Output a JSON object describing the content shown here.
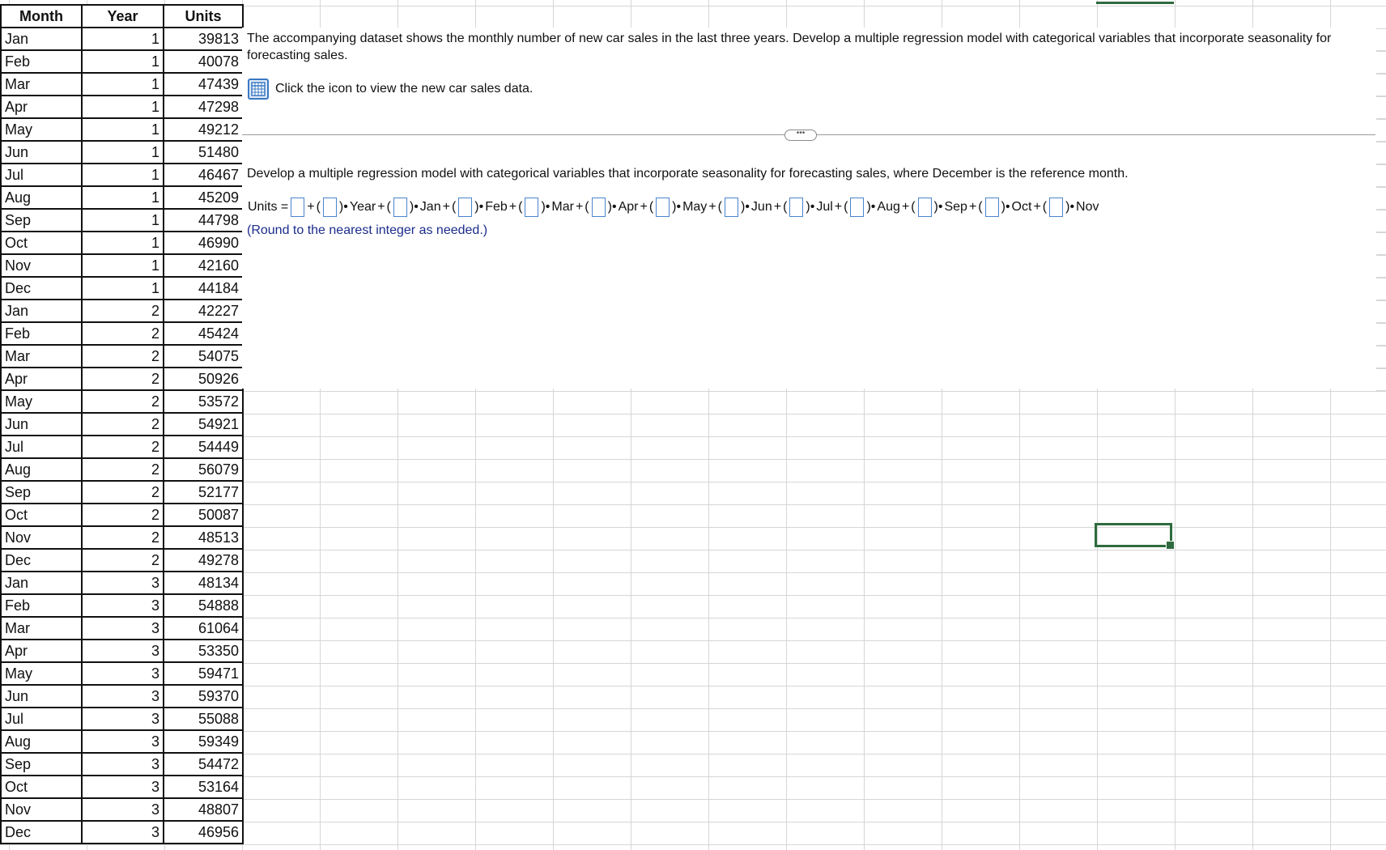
{
  "table": {
    "headers": [
      "Month",
      "Year",
      "Units"
    ],
    "rows": [
      [
        "Jan",
        "1",
        "39813"
      ],
      [
        "Feb",
        "1",
        "40078"
      ],
      [
        "Mar",
        "1",
        "47439"
      ],
      [
        "Apr",
        "1",
        "47298"
      ],
      [
        "May",
        "1",
        "49212"
      ],
      [
        "Jun",
        "1",
        "51480"
      ],
      [
        "Jul",
        "1",
        "46467"
      ],
      [
        "Aug",
        "1",
        "45209"
      ],
      [
        "Sep",
        "1",
        "44798"
      ],
      [
        "Oct",
        "1",
        "46990"
      ],
      [
        "Nov",
        "1",
        "42160"
      ],
      [
        "Dec",
        "1",
        "44184"
      ],
      [
        "Jan",
        "2",
        "42227"
      ],
      [
        "Feb",
        "2",
        "45424"
      ],
      [
        "Mar",
        "2",
        "54075"
      ],
      [
        "Apr",
        "2",
        "50926"
      ],
      [
        "May",
        "2",
        "53572"
      ],
      [
        "Jun",
        "2",
        "54921"
      ],
      [
        "Jul",
        "2",
        "54449"
      ],
      [
        "Aug",
        "2",
        "56079"
      ],
      [
        "Sep",
        "2",
        "52177"
      ],
      [
        "Oct",
        "2",
        "50087"
      ],
      [
        "Nov",
        "2",
        "48513"
      ],
      [
        "Dec",
        "2",
        "49278"
      ],
      [
        "Jan",
        "3",
        "48134"
      ],
      [
        "Feb",
        "3",
        "54888"
      ],
      [
        "Mar",
        "3",
        "61064"
      ],
      [
        "Apr",
        "3",
        "53350"
      ],
      [
        "May",
        "3",
        "59471"
      ],
      [
        "Jun",
        "3",
        "59370"
      ],
      [
        "Jul",
        "3",
        "55088"
      ],
      [
        "Aug",
        "3",
        "59349"
      ],
      [
        "Sep",
        "3",
        "54472"
      ],
      [
        "Oct",
        "3",
        "53164"
      ],
      [
        "Nov",
        "3",
        "48807"
      ],
      [
        "Dec",
        "3",
        "46956"
      ]
    ]
  },
  "question": {
    "intro": "The accompanying dataset shows the monthly number of new car sales in the last three years. Develop a multiple regression model with categorical variables that incorporate seasonality for forecasting sales.",
    "data_link_label": "Click the icon to view the new car sales data.",
    "data_icon": "table-grid-icon",
    "divider_handle": "•••",
    "task": "Develop a multiple regression model with categorical variables that incorporate seasonality for forecasting sales, where December is the reference month.",
    "equation": {
      "lhs": "Units =",
      "plus": "+",
      "terms": [
        "Year",
        "Jan",
        "Feb",
        "Mar",
        "Apr",
        "May",
        "Jun",
        "Jul",
        "Aug",
        "Sep",
        "Oct",
        "Nov"
      ]
    },
    "round_note": "(Round to the nearest integer as needed.)"
  },
  "colors": {
    "selection_green": "#2e6b3e",
    "link_blue": "#1c2c8c",
    "input_border": "#4a84cc"
  }
}
